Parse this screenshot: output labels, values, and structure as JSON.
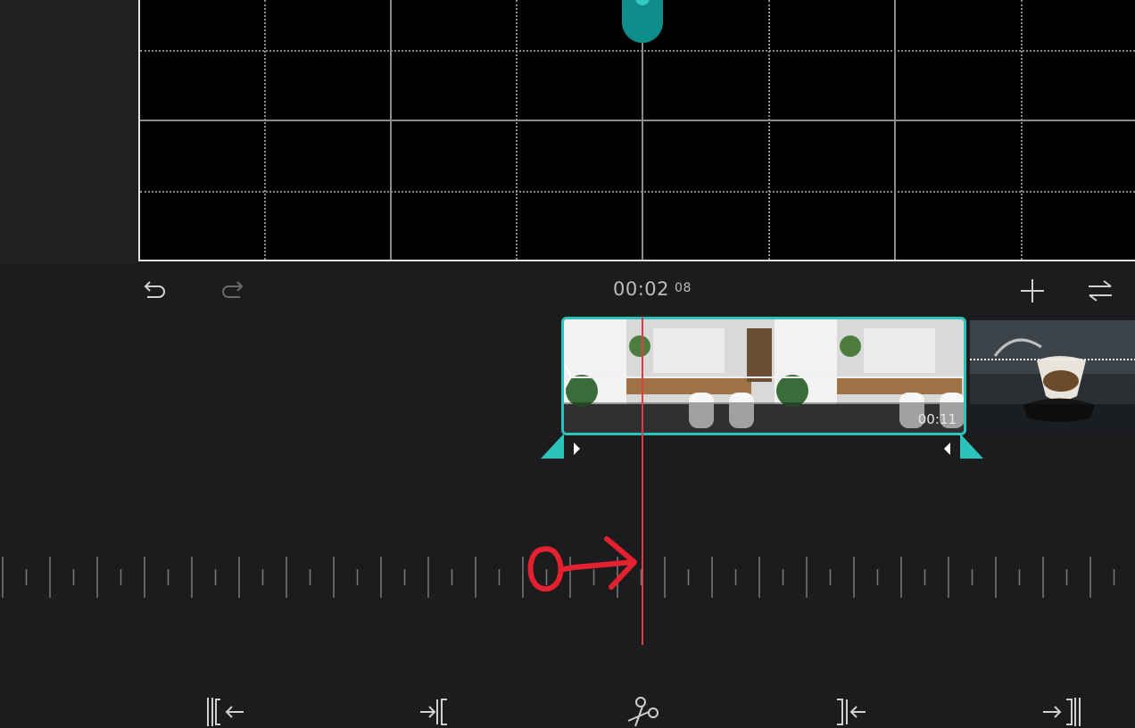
{
  "timecode": {
    "main": "00:02",
    "frames": "08"
  },
  "clip": {
    "duration": "00:11"
  },
  "toolbar": {
    "undo_icon": "undo-icon",
    "redo_icon": "redo-icon",
    "add_icon": "plus-icon",
    "swap_icon": "swap-icon"
  },
  "bottom_tools": [
    "trim-start-icon",
    "trim-in-icon",
    "split-scissors-icon",
    "trim-out-icon",
    "trim-end-icon"
  ],
  "colors": {
    "accent": "#2cc3bc",
    "playhead": "#e43b48",
    "annotation": "#e5202f"
  }
}
